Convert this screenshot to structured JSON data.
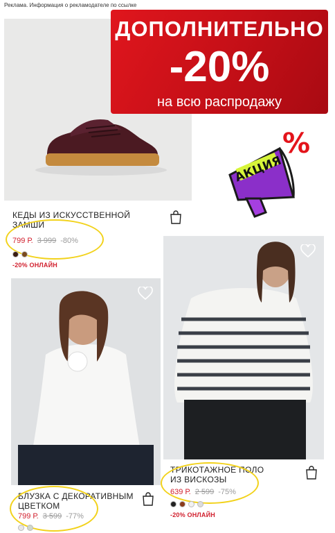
{
  "ad_notice": "Реклама. Информация о рекламодателе по ссылке",
  "banner": {
    "line1": "ДОПОЛНИТЕЛЬНО",
    "line2": "-20%",
    "line3": "на всю распродажу"
  },
  "sticker": {
    "label": "АКЦИЯ",
    "percent": "%"
  },
  "products": [
    {
      "title_line1": "КЕДЫ ИЗ ИСКУССТВЕННОЙ",
      "title_line2": "ЗАМШИ",
      "price": "799 Р.",
      "old_price": "3 999",
      "discount": "-80%",
      "promo": "-20% ОНЛАЙН",
      "colors": [
        "#3a1d12",
        "#7a4a1e"
      ]
    },
    {
      "title_line1": "БЛУЗКА С ДЕКОРАТИВНЫМ",
      "title_line2": "ЦВЕТКОМ",
      "price": "799 Р.",
      "old_price": "3 599",
      "discount": "-77%",
      "colors": [
        "#e8e8e8",
        "#cfd8cc"
      ]
    },
    {
      "title_line1": "ТРИКОТАЖНОЕ ПОЛО",
      "title_line2": "ИЗ ВИСКОЗЫ",
      "price": "639 Р.",
      "old_price": "2 599",
      "discount": "-75%",
      "promo": "-20% ОНЛАЙН",
      "colors": [
        "#222222",
        "#8a3b1c",
        "#f2f2f2",
        "#dcdcdc"
      ]
    }
  ]
}
